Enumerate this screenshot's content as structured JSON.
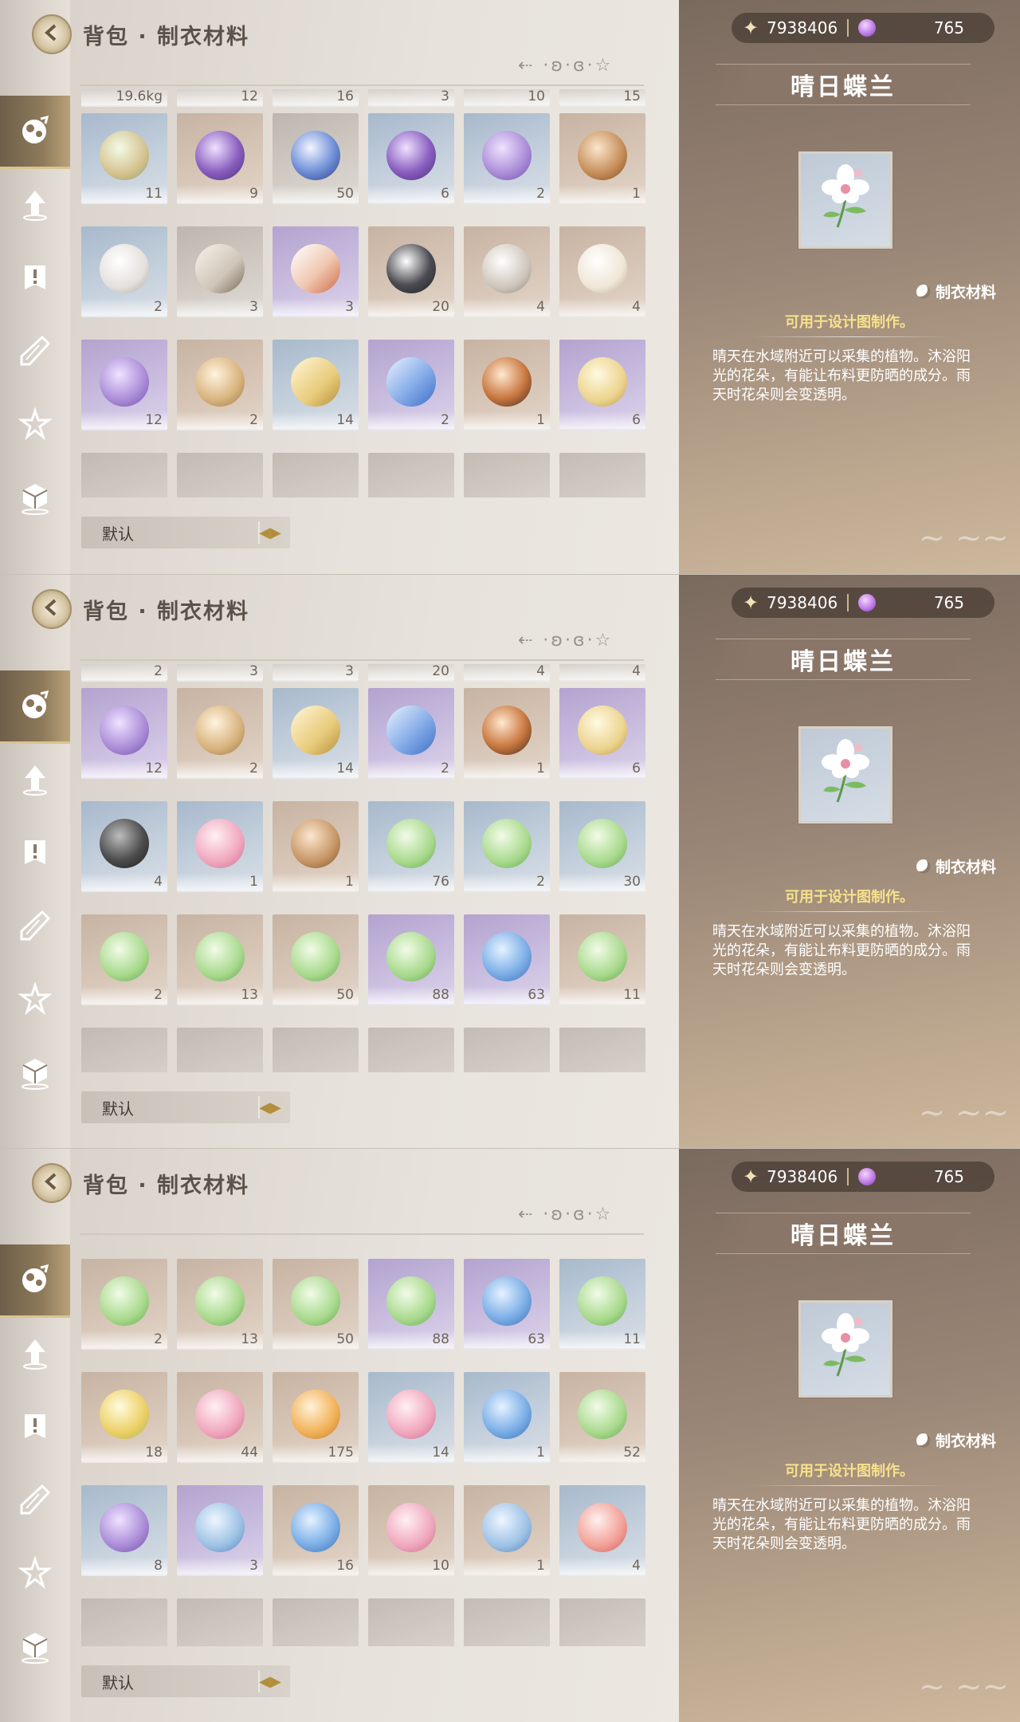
{
  "colors": {
    "accent": "#b38e3a",
    "usage_text": "#f6e18c",
    "panel_dark": "#7a6a5e"
  },
  "screens": [
    {
      "title": "背包 · 制衣材料",
      "sort_deco": "⇠ ·ʚ·ɞ·☆",
      "sort_label": "默认",
      "currency": {
        "stars": "7938406",
        "gems": "765"
      },
      "detail": {
        "name": "晴日蝶兰",
        "category": "制衣材料",
        "usage": "可用于设计图制作。",
        "description": "晴天在水域附近可以采集的植物。沐浴阳光的花朵，有能让布料更防晒的成分。雨天时花朵则会变透明。"
      },
      "partial_top": [
        "19.6kg",
        "12",
        "16",
        "3",
        "10",
        "15"
      ],
      "rows": [
        [
          {
            "icon": "fairy-moth-icon",
            "count": "11",
            "bg": "blue"
          },
          {
            "icon": "beetle-icon",
            "count": "9",
            "bg": "tan"
          },
          {
            "icon": "blue-butterfly-icon",
            "count": "50",
            "bg": "gray"
          },
          {
            "icon": "white-beetle-icon",
            "count": "6",
            "bg": "blue"
          },
          {
            "icon": "purple-butterfly-icon",
            "count": "2",
            "bg": "blue"
          },
          {
            "icon": "heart-cookie-icon",
            "count": "1",
            "bg": "tan"
          }
        ],
        [
          {
            "icon": "white-fluff-icon",
            "count": "2",
            "bg": "blue"
          },
          {
            "icon": "horn-icon",
            "count": "3",
            "bg": "gray"
          },
          {
            "icon": "origami-icon",
            "count": "3",
            "bg": "purple"
          },
          {
            "icon": "cat-mask-icon",
            "count": "20",
            "bg": "tan"
          },
          {
            "icon": "feather-icon",
            "count": "4",
            "bg": "tan"
          },
          {
            "icon": "yarn-ball-icon",
            "count": "4",
            "bg": "tan"
          }
        ],
        [
          {
            "icon": "purple-shell-icon",
            "count": "12",
            "bg": "purple"
          },
          {
            "icon": "seed-icon",
            "count": "2",
            "bg": "tan"
          },
          {
            "icon": "golden-feather-icon",
            "count": "14",
            "bg": "blue"
          },
          {
            "icon": "blue-feather-icon",
            "count": "2",
            "bg": "purple"
          },
          {
            "icon": "fox-mask-icon",
            "count": "1",
            "bg": "tan"
          },
          {
            "icon": "gold-fur-icon",
            "count": "6",
            "bg": "purple"
          }
        ]
      ]
    },
    {
      "title": "背包 · 制衣材料",
      "sort_deco": "⇠ ·ʚ·ɞ·☆",
      "sort_label": "默认",
      "currency": {
        "stars": "7938406",
        "gems": "765"
      },
      "detail": {
        "name": "晴日蝶兰",
        "category": "制衣材料",
        "usage": "可用于设计图制作。",
        "description": "晴天在水域附近可以采集的植物。沐浴阳光的花朵，有能让布料更防晒的成分。雨天时花朵则会变透明。"
      },
      "partial_top": [
        "2",
        "3",
        "3",
        "20",
        "4",
        "4"
      ],
      "rows": [
        [
          {
            "icon": "purple-shell-icon",
            "count": "12",
            "bg": "purple"
          },
          {
            "icon": "seed-icon",
            "count": "2",
            "bg": "tan"
          },
          {
            "icon": "golden-feather-icon",
            "count": "14",
            "bg": "blue"
          },
          {
            "icon": "blue-feather-icon",
            "count": "2",
            "bg": "purple"
          },
          {
            "icon": "fox-mask-icon",
            "count": "1",
            "bg": "tan"
          },
          {
            "icon": "gold-fur-icon",
            "count": "6",
            "bg": "purple"
          }
        ],
        [
          {
            "icon": "black-shell-icon",
            "count": "4",
            "bg": "blue"
          },
          {
            "icon": "pink-shell-icon",
            "count": "1",
            "bg": "blue"
          },
          {
            "icon": "hair-curl-icon",
            "count": "1",
            "bg": "tan"
          },
          {
            "icon": "green-leaf-lily-icon",
            "count": "76",
            "bg": "blue"
          },
          {
            "icon": "green-leaf-sprout-icon",
            "count": "2",
            "bg": "blue"
          },
          {
            "icon": "lotus-leaf-icon",
            "count": "30",
            "bg": "blue"
          }
        ],
        [
          {
            "icon": "apple-leaf-icon",
            "count": "2",
            "bg": "tan"
          },
          {
            "icon": "dandelion-leaf-icon",
            "count": "13",
            "bg": "tan"
          },
          {
            "icon": "yellow-flower-leaf-icon",
            "count": "50",
            "bg": "tan"
          },
          {
            "icon": "orchid-leaf-icon",
            "count": "88",
            "bg": "purple"
          },
          {
            "icon": "blue-berry-leaf-icon",
            "count": "63",
            "bg": "purple"
          },
          {
            "icon": "daisy-leaf-icon",
            "count": "11",
            "bg": "tan"
          }
        ]
      ]
    },
    {
      "title": "背包 · 制衣材料",
      "sort_deco": "⇠ ·ʚ·ɞ·☆",
      "sort_label": "默认",
      "currency": {
        "stars": "7938406",
        "gems": "765"
      },
      "detail": {
        "name": "晴日蝶兰",
        "category": "制衣材料",
        "usage": "可用于设计图制作。",
        "description": "晴天在水域附近可以采集的植物。沐浴阳光的花朵，有能让布料更防晒的成分。雨天时花朵则会变透明。"
      },
      "partial_top": [],
      "rows": [
        [
          {
            "icon": "apple-leaf-icon",
            "count": "2",
            "bg": "tan"
          },
          {
            "icon": "dandelion-leaf-icon",
            "count": "13",
            "bg": "tan"
          },
          {
            "icon": "yellow-flower-leaf-icon",
            "count": "50",
            "bg": "tan"
          },
          {
            "icon": "orchid-leaf-icon",
            "count": "88",
            "bg": "purple"
          },
          {
            "icon": "blue-berry-leaf-icon",
            "count": "63",
            "bg": "purple"
          },
          {
            "icon": "daisy-leaf-icon",
            "count": "11",
            "bg": "blue"
          }
        ],
        [
          {
            "icon": "lemon-leaf-icon",
            "count": "18",
            "bg": "tan"
          },
          {
            "icon": "pink-bloom-leaf-icon",
            "count": "44",
            "bg": "tan"
          },
          {
            "icon": "orange-fruit-leaf-icon",
            "count": "175",
            "bg": "tan"
          },
          {
            "icon": "pink-shrimp-leaf-icon",
            "count": "14",
            "bg": "blue"
          },
          {
            "icon": "blue-petal-leaf-icon",
            "count": "1",
            "bg": "blue"
          },
          {
            "icon": "tulip-leaf-icon",
            "count": "52",
            "bg": "tan"
          }
        ],
        [
          {
            "icon": "purple-fish-bubble-icon",
            "count": "8",
            "bg": "blue"
          },
          {
            "icon": "silver-fish-bubble-icon",
            "count": "3",
            "bg": "purple"
          },
          {
            "icon": "blue-fish-bubble-icon",
            "count": "16",
            "bg": "tan"
          },
          {
            "icon": "pink-fish-bubble-icon",
            "count": "10",
            "bg": "tan"
          },
          {
            "icon": "dark-fish-bubble-icon",
            "count": "1",
            "bg": "tan"
          },
          {
            "icon": "red-fish-bubble-icon",
            "count": "4",
            "bg": "blue"
          }
        ]
      ]
    }
  ]
}
